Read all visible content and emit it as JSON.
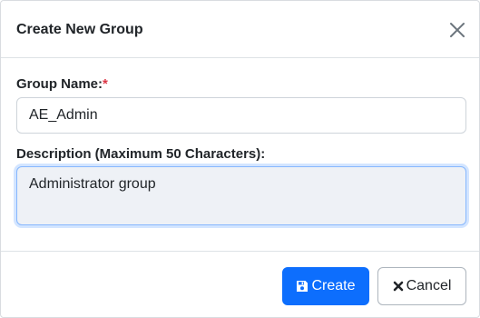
{
  "dialog": {
    "title": "Create New Group",
    "close_icon": "close-icon"
  },
  "form": {
    "group_name_label": "Group Name:",
    "required_marker": "*",
    "group_name_value": "AE_Admin",
    "description_label": "Description (Maximum 50 Characters):",
    "description_value": "Administrator group"
  },
  "footer": {
    "create_label": "Create",
    "create_icon": "save-icon",
    "cancel_label": "Cancel",
    "cancel_icon": "times-icon"
  },
  "colors": {
    "primary": "#0d6efd",
    "required": "#dc3545",
    "focused_field_bg": "#eef1f6"
  }
}
